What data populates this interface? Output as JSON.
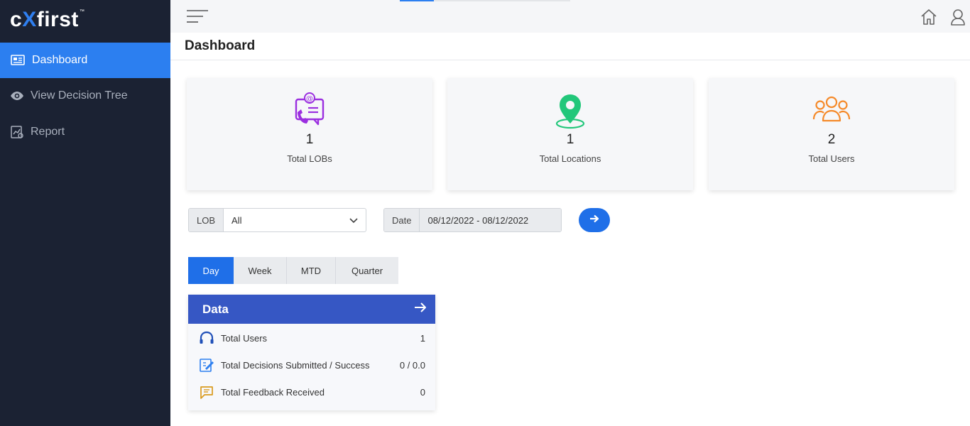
{
  "app": {
    "logo_main": "c",
    "logo_x": "X",
    "logo_rest": "first",
    "logo_tm": "™"
  },
  "sidebar": {
    "items": [
      {
        "label": "Dashboard",
        "icon": "dashboard-icon",
        "active": true
      },
      {
        "label": "View Decision Tree",
        "icon": "eye-icon",
        "active": false
      },
      {
        "label": "Report",
        "icon": "report-icon",
        "active": false
      }
    ]
  },
  "topbar": {
    "progress_percent": 20,
    "icons": [
      "hamburger-menu-icon",
      "home-icon",
      "user-icon"
    ]
  },
  "page": {
    "title": "Dashboard"
  },
  "stats": [
    {
      "value": "1",
      "label": "Total LOBs",
      "icon": "lob-chat-icon",
      "color": "#9b2fe0"
    },
    {
      "value": "1",
      "label": "Total Locations",
      "icon": "location-pin-icon",
      "color": "#22c77a"
    },
    {
      "value": "2",
      "label": "Total Users",
      "icon": "users-group-icon",
      "color": "#f58a2a"
    }
  ],
  "filters": {
    "lob_label": "LOB",
    "lob_value": "All",
    "date_label": "Date",
    "date_value": "08/12/2022 - 08/12/2022"
  },
  "tabs": [
    {
      "label": "Day",
      "active": true
    },
    {
      "label": "Week",
      "active": false
    },
    {
      "label": "MTD",
      "active": false
    },
    {
      "label": "Quarter",
      "active": false
    }
  ],
  "data_panel": {
    "title": "Data",
    "rows": [
      {
        "label": "Total Users",
        "value": "1",
        "icon": "headset-icon"
      },
      {
        "label": "Total Decisions Submitted / Success",
        "value": "0 / 0.0",
        "icon": "decision-icon"
      },
      {
        "label": "Total Feedback Received",
        "value": "0",
        "icon": "feedback-icon"
      }
    ]
  },
  "colors": {
    "sidebar_bg": "#1b2233",
    "accent": "#2c7ff0",
    "panel_header": "#3657c4"
  }
}
